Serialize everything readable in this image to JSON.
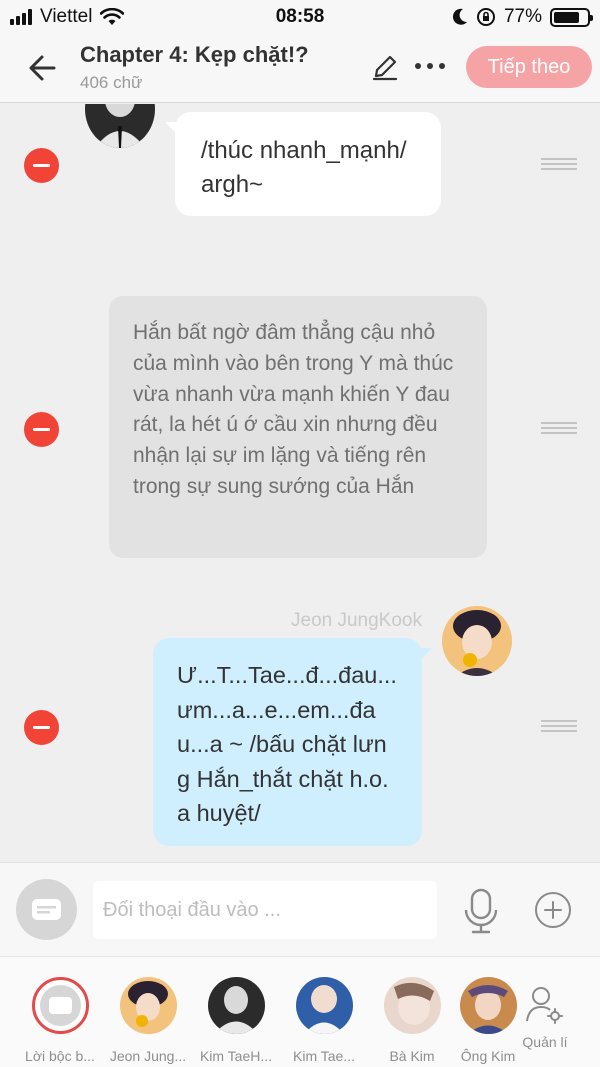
{
  "status": {
    "carrier": "Viettel",
    "time": "08:58",
    "battery": "77%",
    "battery_level": 0.77
  },
  "header": {
    "title": "Chapter 4: Kẹp chặt!?",
    "subtitle": "406 chữ",
    "next_label": "Tiếp theo"
  },
  "messages": [
    {
      "type": "character",
      "text": "/thúc nhanh_mạnh/ argh~"
    },
    {
      "type": "narration",
      "text": "Hắn bất ngờ đâm thẳng cậu nhỏ của mình vào bên trong Y mà thúc vừa nhanh vừa mạnh khiến Y đau rát, la hét ú ớ cầu xin nhưng đều nhận lại sự im lặng và tiếng rên trong sự sung sướng của Hắn"
    },
    {
      "type": "character",
      "name": "Jeon JungKook",
      "text": "Ư...T...Tae...đ...đau...ưm...a...e...em...đau...a ~ /bấu chặt lưng Hắn_thắt chặt h.o.a huyệt/"
    }
  ],
  "input": {
    "placeholder": "Đối thoại đầu vào ..."
  },
  "characters": [
    {
      "name": "Lời bộc b..."
    },
    {
      "name": "Jeon Jung..."
    },
    {
      "name": "Kim TaeH..."
    },
    {
      "name": "Kim Tae..."
    },
    {
      "name": "Bà Kim"
    },
    {
      "name": "Ông Kim"
    }
  ],
  "manage_label": "Quản lí",
  "colors": {
    "accent": "#f6a3a5",
    "remove": "#f14336",
    "bubble_blue": "#cfeefe",
    "narration_bg": "#e2e2e2"
  }
}
